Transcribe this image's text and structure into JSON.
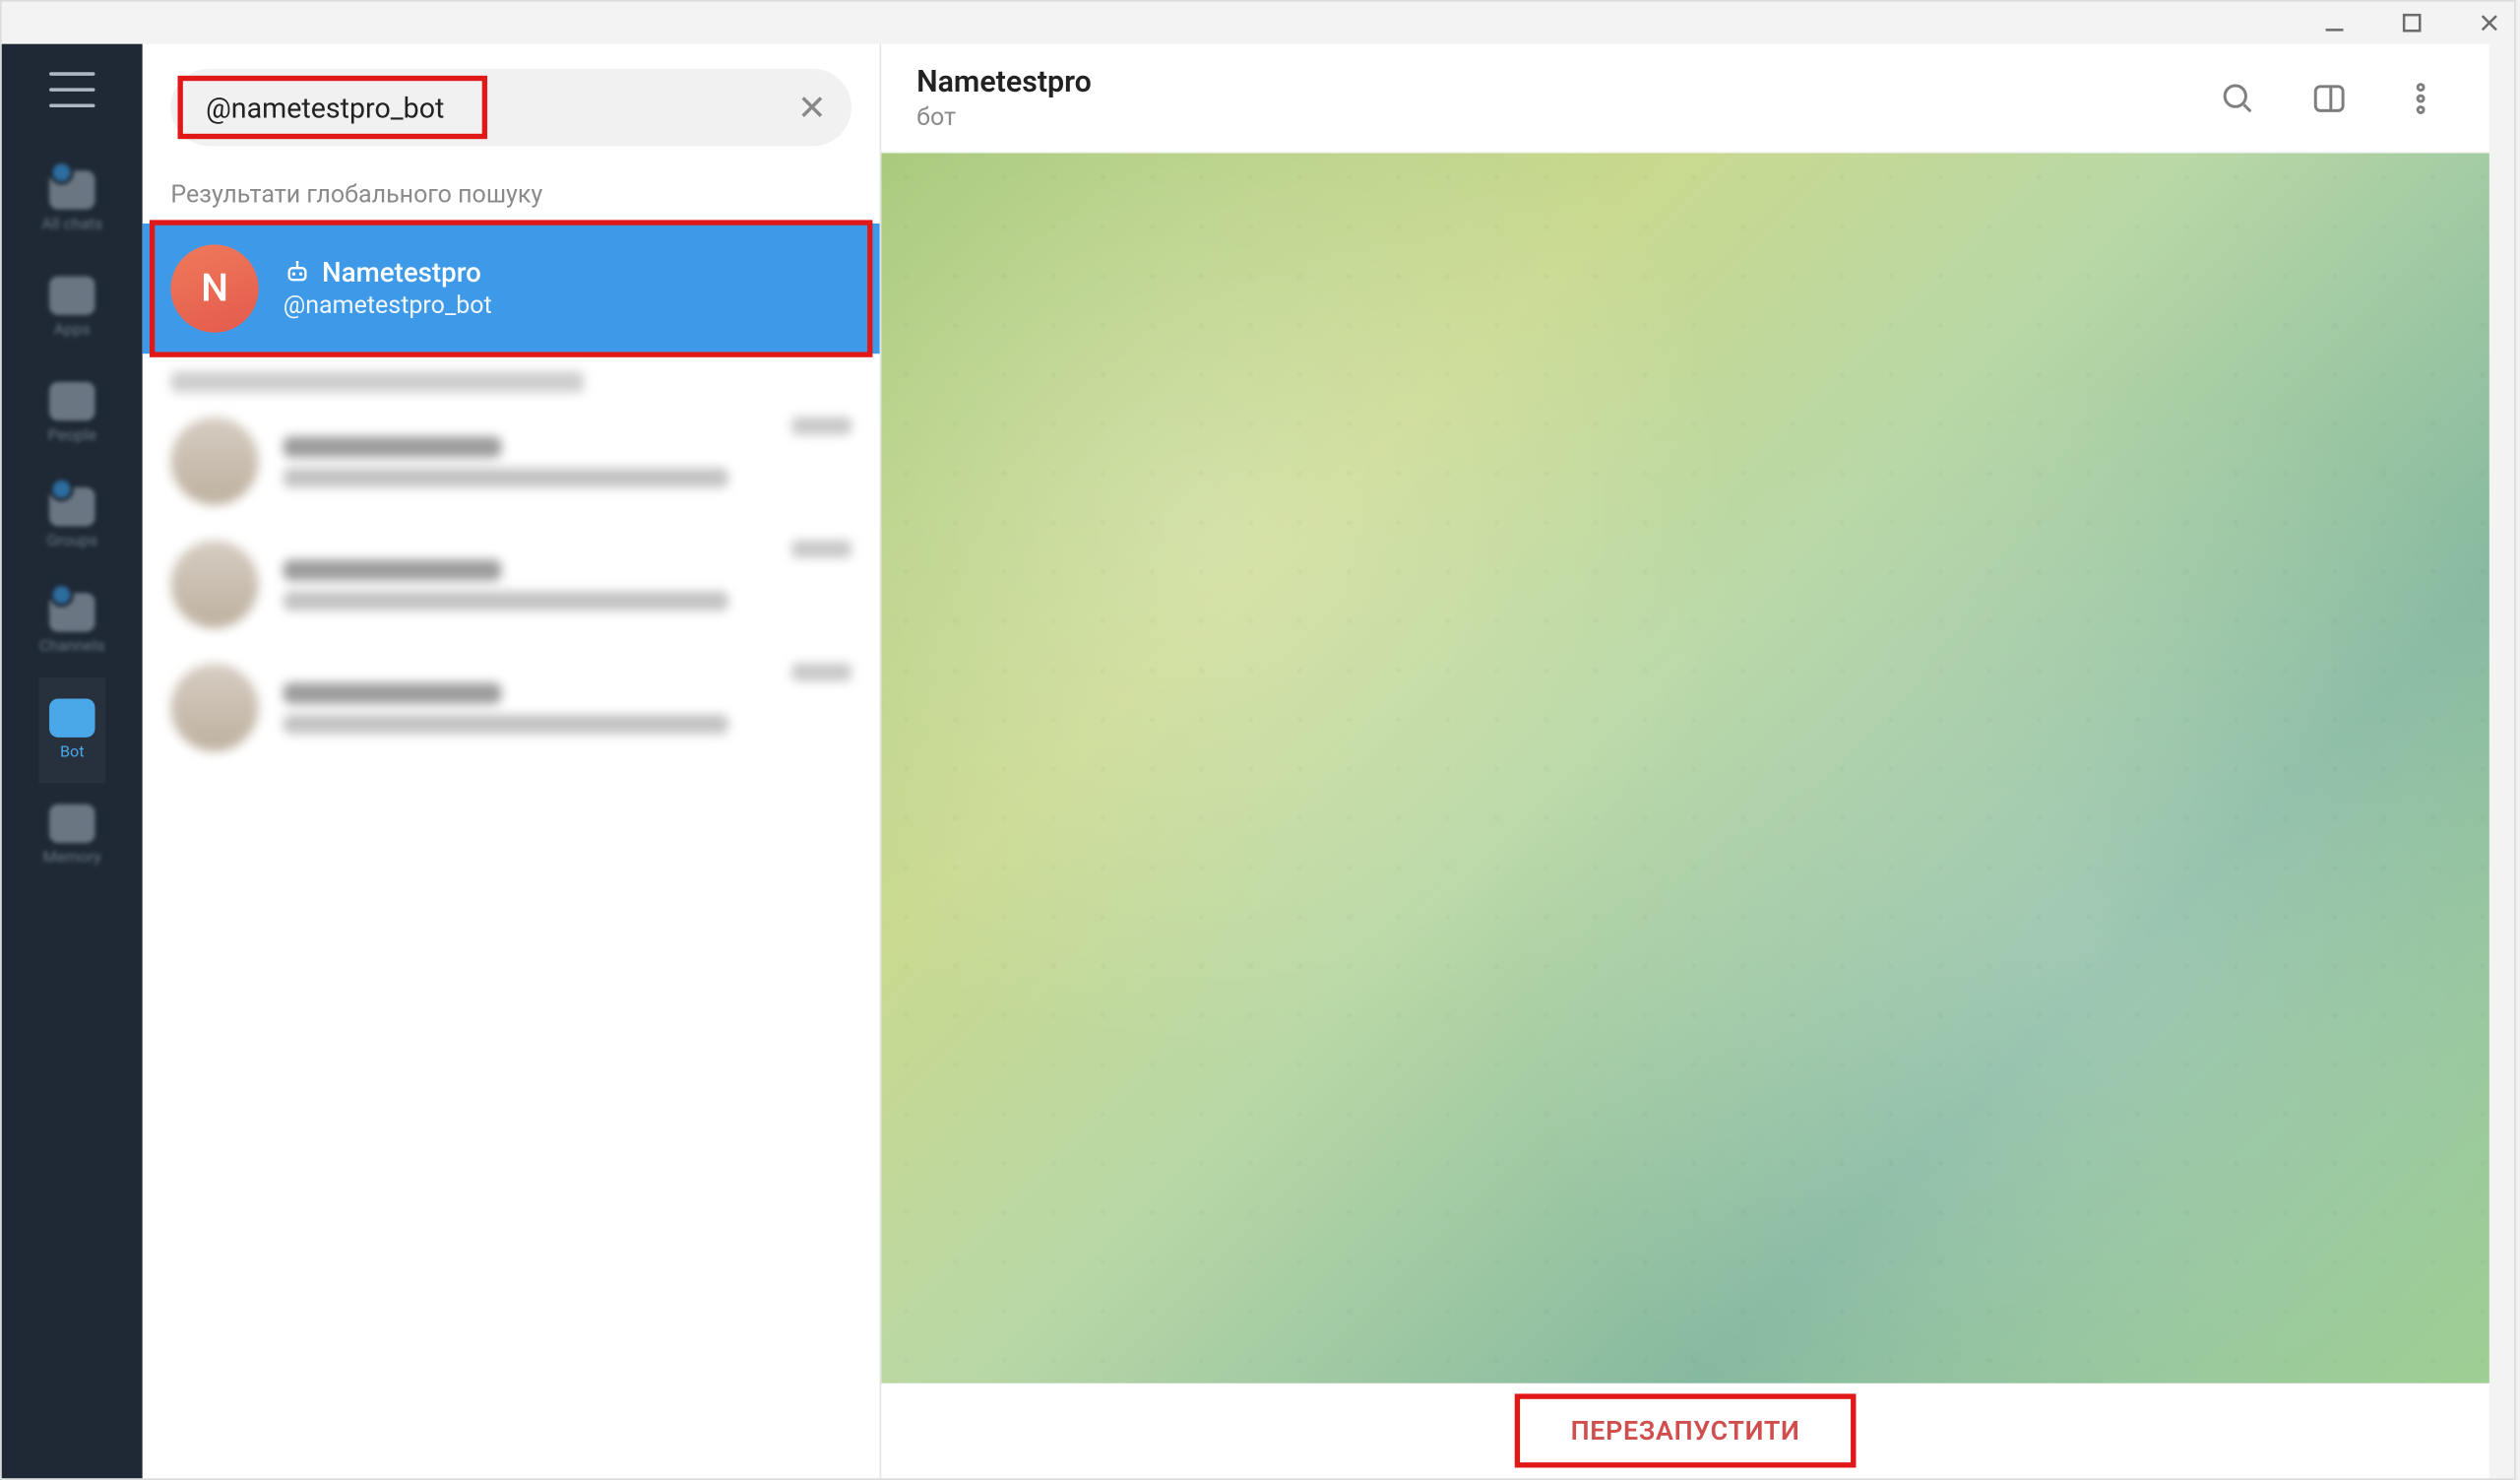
{
  "search": {
    "value": "@nametestpro_bot"
  },
  "sections": {
    "global_label": "Результати глобального пошуку"
  },
  "result": {
    "avatar_letter": "N",
    "title": "Nametestpro",
    "username": "@nametestpro_bot"
  },
  "chat": {
    "title": "Nametestpro",
    "subtitle": "бот",
    "restart_label": "ПЕРЕЗАПУСТИТИ"
  },
  "nav": {
    "items": [
      {
        "label": "All chats",
        "badge": true,
        "active": false
      },
      {
        "label": "Apps",
        "badge": false,
        "active": false
      },
      {
        "label": "People",
        "badge": false,
        "active": false
      },
      {
        "label": "Groups",
        "badge": true,
        "active": false
      },
      {
        "label": "Channels",
        "badge": true,
        "active": false
      },
      {
        "label": "Bot",
        "badge": false,
        "active": true
      },
      {
        "label": "Memory",
        "badge": false,
        "active": false
      }
    ]
  }
}
